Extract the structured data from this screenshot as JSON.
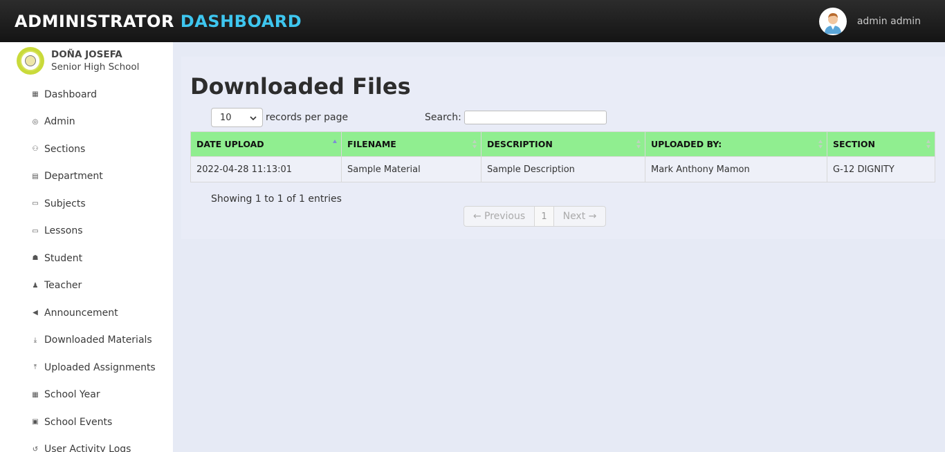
{
  "header": {
    "brand_main": "ADMINISTRATOR",
    "brand_accent": "DASHBOARD",
    "user_name": "admin admin"
  },
  "sidebar": {
    "school_line1": "DOÑA JOSEFA",
    "school_line2": "Senior High School",
    "items": [
      {
        "label": "Dashboard",
        "icon": "▦"
      },
      {
        "label": "Admin",
        "icon": "◎"
      },
      {
        "label": "Sections",
        "icon": "⚇"
      },
      {
        "label": "Department",
        "icon": "▤"
      },
      {
        "label": "Subjects",
        "icon": "▭"
      },
      {
        "label": "Lessons",
        "icon": "▭"
      },
      {
        "label": "Student",
        "icon": "☗"
      },
      {
        "label": "Teacher",
        "icon": "♟"
      },
      {
        "label": "Announcement",
        "icon": "◀"
      },
      {
        "label": "Downloaded Materials",
        "icon": "⤓"
      },
      {
        "label": "Uploaded Assignments",
        "icon": "⤒"
      },
      {
        "label": "School Year",
        "icon": "▦"
      },
      {
        "label": "School Events",
        "icon": "▣"
      },
      {
        "label": "User Activity Logs",
        "icon": "↺"
      }
    ]
  },
  "main": {
    "title": "Downloaded Files",
    "length_value": "10",
    "length_label": "records per page",
    "search_label": "Search:",
    "columns": [
      "DATE UPLOAD",
      "FILENAME",
      "DESCRIPTION",
      "UPLOADED BY:",
      "SECTION"
    ],
    "rows": [
      [
        "2022-04-28 11:13:01",
        "Sample Material",
        "Sample Description",
        "Mark Anthony Mamon",
        "G-12 DIGNITY"
      ]
    ],
    "info": "Showing 1 to 1 of 1 entries",
    "pager": {
      "prev": "← Previous",
      "page": "1",
      "next": "Next →"
    }
  },
  "colors": {
    "accent": "#3ec6ef",
    "table_header": "#90ee90",
    "topbar": "#1a1a1a",
    "main_bg": "#e6eaf5"
  }
}
